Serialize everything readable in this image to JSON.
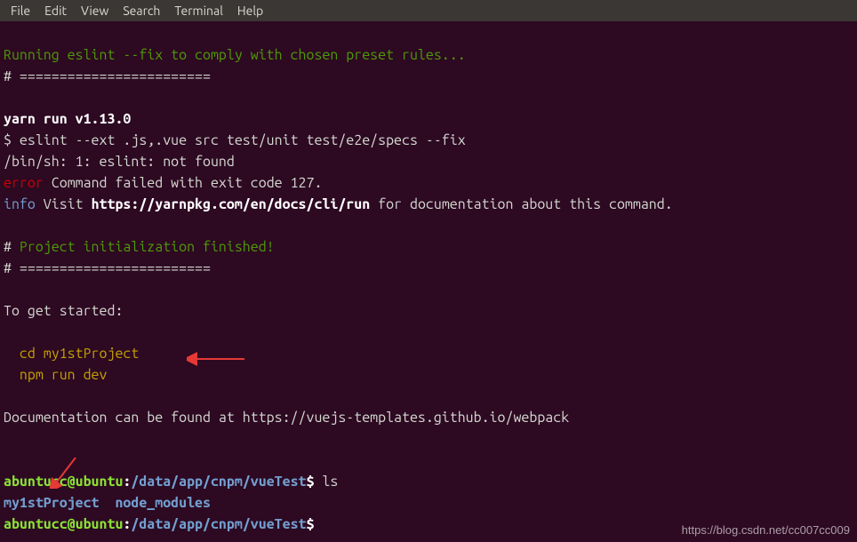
{
  "menubar": {
    "file": "File",
    "edit": "Edit",
    "view": "View",
    "search": "Search",
    "terminal": "Terminal",
    "help": "Help"
  },
  "lines": {
    "running_eslint": "Running eslint --fix to comply with chosen preset rules...",
    "hash1": "# ",
    "equals1": "========================",
    "yarn_run": "yarn run v1.13.0",
    "eslint_cmd_prefix": "$ ",
    "eslint_cmd": "eslint --ext .js,.vue src test/unit test/e2e/specs --fix",
    "binsh": "/bin/sh: 1: eslint: not found",
    "error_label": "error",
    "error_text": " Command failed with exit code 127.",
    "info_label": "info",
    "info_text1": " Visit ",
    "info_url": "https://yarnpkg.com/en/docs/cli/run",
    "info_text2": " for documentation about this command.",
    "hash2": "# ",
    "project_init": "Project initialization finished!",
    "hash3": "# ",
    "equals2": "========================",
    "get_started": "To get started:",
    "cd_cmd": "  cd my1stProject",
    "npm_cmd": "  npm run dev",
    "docs": "Documentation can be found at https://vuejs-templates.github.io/webpack",
    "prompt_user1": "abuntucc@ubuntu",
    "prompt_colon1": ":",
    "prompt_path1": "/data/app/cnpm/vueTest",
    "prompt_dollar1": "$ ",
    "ls_cmd": "ls",
    "ls_out1": "my1stProject",
    "ls_out_gap": "  ",
    "ls_out2": "node_modules",
    "prompt_user2": "abuntucc@ubuntu",
    "prompt_colon2": ":",
    "prompt_path2": "/data/app/cnpm/vueTest",
    "prompt_dollar2": "$"
  },
  "watermark": "https://blog.csdn.net/cc007cc009"
}
